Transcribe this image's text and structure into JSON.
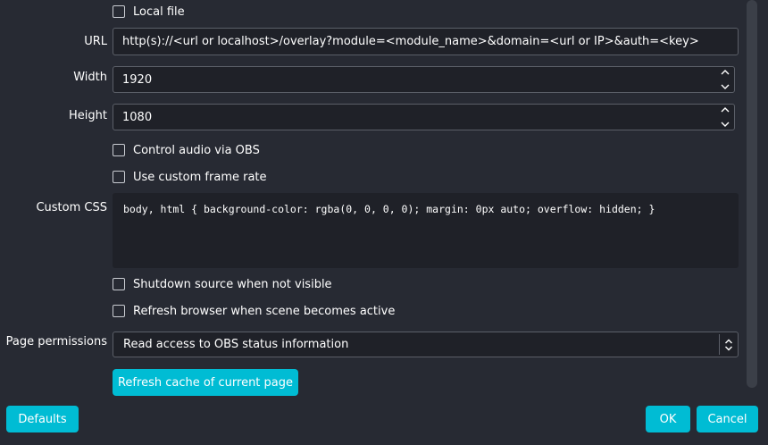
{
  "local_file": {
    "label": "Local file",
    "checked": false
  },
  "url": {
    "label": "URL",
    "value": "http(s)://<url or localhost>/overlay?module=<module_name>&domain=<url or IP>&auth=<key>"
  },
  "width": {
    "label": "Width",
    "value": "1920"
  },
  "height": {
    "label": "Height",
    "value": "1080"
  },
  "control_audio": {
    "label": "Control audio via OBS",
    "checked": false
  },
  "custom_frame_rate": {
    "label": "Use custom frame rate",
    "checked": false
  },
  "custom_css": {
    "label": "Custom CSS",
    "value": "body, html { background-color: rgba(0, 0, 0, 0); margin: 0px auto; overflow: hidden; }"
  },
  "shutdown_source": {
    "label": "Shutdown source when not visible",
    "checked": false
  },
  "refresh_browser": {
    "label": "Refresh browser when scene becomes active",
    "checked": false
  },
  "page_permissions": {
    "label": "Page permissions",
    "selected": "Read access to OBS status information"
  },
  "refresh_cache_button": {
    "label": "Refresh cache of current page"
  },
  "defaults_button": {
    "label": "Defaults"
  },
  "ok_button": {
    "label": "OK"
  },
  "cancel_button": {
    "label": "Cancel"
  },
  "colors": {
    "background": "#272a33",
    "field": "#1f2128",
    "accent": "#00bcd4",
    "border": "#5b5f68"
  }
}
